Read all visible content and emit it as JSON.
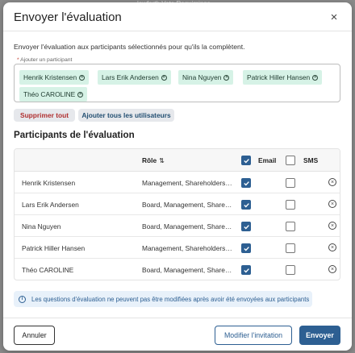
{
  "backdrop": {
    "text": "lowforth Vote Requimings"
  },
  "dialog": {
    "title": "Envoyer l'évaluation",
    "close_label": "×",
    "description": "Envoyer l'évaluation aux participants sélectionnés pour qu'ils la complètent.",
    "participant_input": {
      "required_mark": "*",
      "label": "Ajouter un participant",
      "chips": [
        "Henrik Kristensen",
        "Lars Erik Andersen",
        "Nina Nguyen",
        "Patrick Hiller Hansen",
        "Théo CAROLINE"
      ]
    },
    "actions": {
      "delete_all": "Supprimer tout",
      "add_all": "Ajouter tous les utilisateurs"
    },
    "section_title": "Participants de l'évaluation",
    "table": {
      "columns": {
        "role": "Rôle",
        "email": "Email",
        "sms": "SMS"
      },
      "header_email_checked": true,
      "header_sms_checked": false,
      "rows": [
        {
          "name": "Henrik Kristensen",
          "role": "Management, Shareholders, Board",
          "email": true,
          "sms": false
        },
        {
          "name": "Lars Erik Andersen",
          "role": "Board, Management, Shareholders",
          "email": true,
          "sms": false
        },
        {
          "name": "Nina Nguyen",
          "role": "Board, Management, Shareholders",
          "email": true,
          "sms": false
        },
        {
          "name": "Patrick Hiller Hansen",
          "role": "Management, Shareholders, Board",
          "email": true,
          "sms": false
        },
        {
          "name": "Théo CAROLINE",
          "role": "Board, Management, Shareholders",
          "email": true,
          "sms": false
        }
      ]
    },
    "info_banner": "Les questions d'évaluation ne peuvent pas être modifiées après avoir été envoyées aux participants",
    "footer": {
      "cancel": "Annuler",
      "edit_invitation": "Modifier l'invitation",
      "send": "Envoyer"
    }
  },
  "colors": {
    "primary": "#2d5f92",
    "chip_bg": "#d6f2e6",
    "danger": "#b03030"
  }
}
